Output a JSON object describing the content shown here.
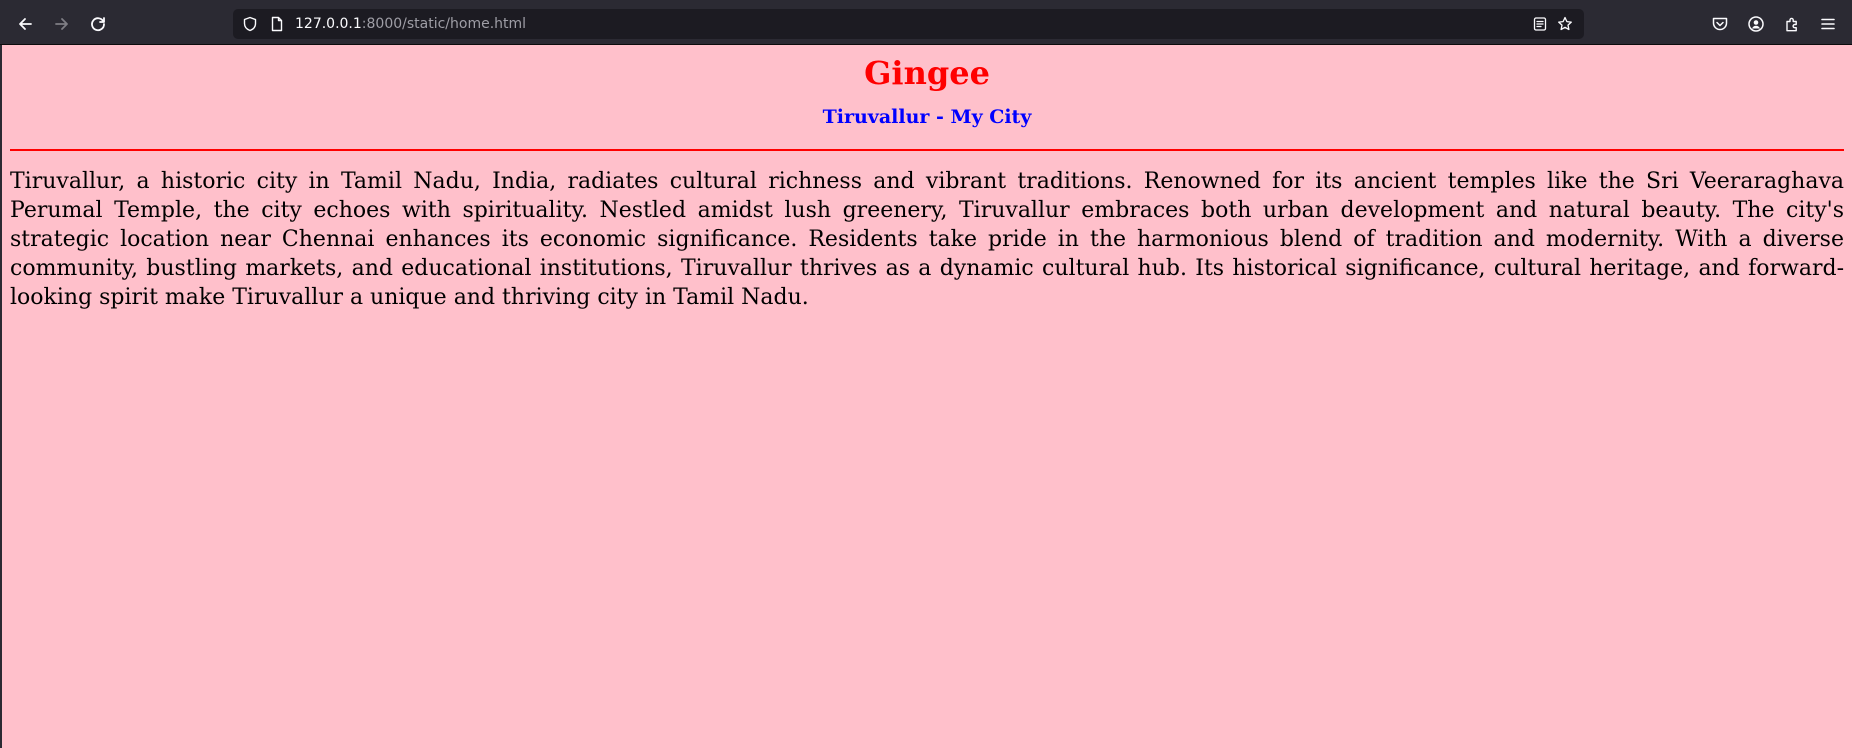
{
  "browser": {
    "url_host": "127.0.0.1",
    "url_path": ":8000/static/home.html",
    "icons": {
      "back": "back-arrow-icon",
      "forward": "forward-arrow-icon",
      "reload": "reload-icon",
      "tracking": "shield-icon",
      "page": "page-icon",
      "reader": "reader-view-icon",
      "bookmark": "star-icon",
      "pocket": "pocket-icon",
      "account": "account-icon",
      "extensions": "extensions-icon",
      "menu": "hamburger-menu-icon"
    }
  },
  "page": {
    "background_color": "#ffc0cb",
    "title": "Gingee",
    "title_color": "#ff0000",
    "subtitle": "Tiruvallur - My City",
    "subtitle_color": "#0000ff",
    "divider_color": "#ff0000",
    "paragraph": "Tiruvallur, a historic city in Tamil Nadu, India, radiates cultural richness and vibrant traditions. Renowned for its ancient temples like the Sri Veeraraghava Perumal Temple, the city echoes with spirituality. Nestled amidst lush greenery, Tiruvallur embraces both urban development and natural beauty. The city's strategic location near Chennai enhances its economic significance. Residents take pride in the harmonious blend of tradition and modernity. With a diverse community, bustling markets, and educational institutions, Tiruvallur thrives as a dynamic cultural hub. Its historical significance, cultural heritage, and forward-looking spirit make Tiruvallur a unique and thriving city in Tamil Nadu."
  }
}
